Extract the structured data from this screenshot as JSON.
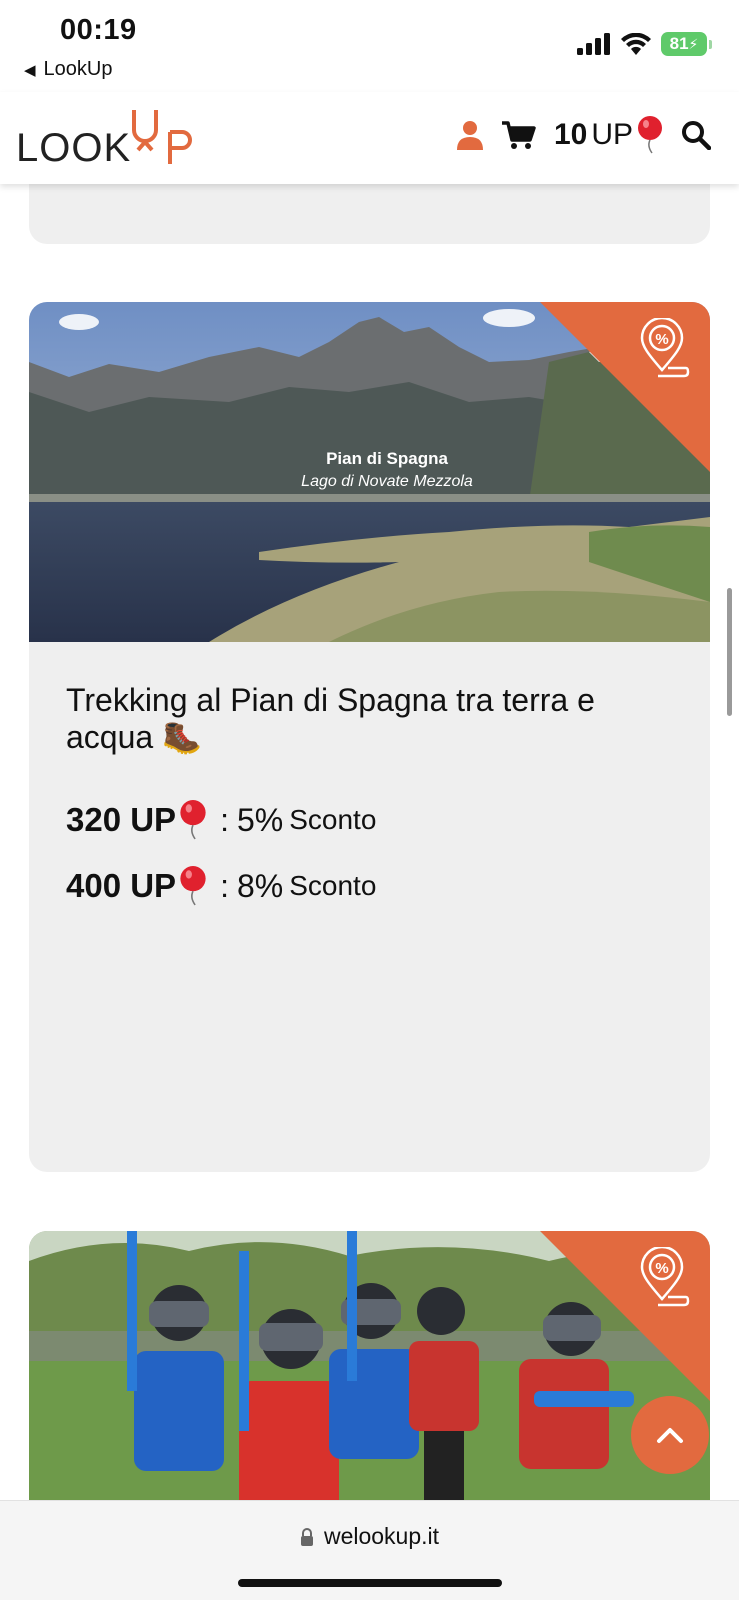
{
  "status_bar": {
    "time": "00:19",
    "back_label": "LookUp",
    "battery": "81",
    "icons": [
      "signal-icon",
      "wifi-icon",
      "battery-icon"
    ]
  },
  "header": {
    "logo_text": "LOOK",
    "logo_accent": "UP",
    "up_amount": "10",
    "up_unit": "UP",
    "icons": [
      "user-icon",
      "cart-icon",
      "balloon-icon",
      "search-icon"
    ]
  },
  "colors": {
    "accent": "#e26a3f",
    "card_bg": "#efefef",
    "battery": "#5fca6a"
  },
  "cards": [
    {
      "image_caption_title": "Pian di Spagna",
      "image_caption_subtitle": "Lago di Novate Mezzola",
      "title": "Trekking al Pian di Spagna tra terra e acqua 🥾",
      "prices": [
        {
          "amount": "320 UP",
          "percent": "5%",
          "label": "Sconto"
        },
        {
          "amount": "400 UP",
          "percent": "8%",
          "label": "Sconto"
        }
      ],
      "badge_icon": "discount-location-icon"
    },
    {
      "badge_icon": "discount-location-icon"
    }
  ],
  "browser": {
    "url": "welookup.it"
  }
}
